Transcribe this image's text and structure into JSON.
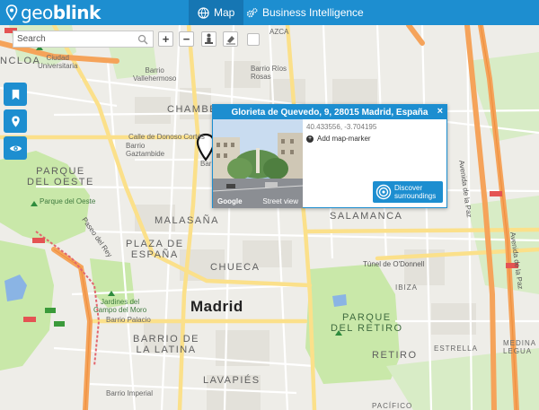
{
  "header": {
    "logo_light": "geo",
    "logo_bold": "blink",
    "tabs": [
      {
        "label": "Map",
        "active": true,
        "icon": "globe-icon"
      },
      {
        "label": "Business Intelligence",
        "active": false,
        "icon": "gears-icon"
      }
    ]
  },
  "toolbar": {
    "search_placeholder": "Search",
    "zoom_in": "+",
    "zoom_out": "−"
  },
  "sidebar": {
    "buttons": [
      {
        "icon": "bookmark-icon"
      },
      {
        "icon": "location-pin-icon"
      },
      {
        "icon": "eye-icon"
      }
    ]
  },
  "popup": {
    "title": "Glorieta de Quevedo, 9, 28015 Madrid, España",
    "close": "×",
    "coords": "40.433556, -3.704195",
    "add_marker": "Add map-marker",
    "discover_line1": "Discover",
    "discover_line2": "surroundings",
    "photo_brand": "Google",
    "photo_caption": "Street view"
  },
  "map_labels": {
    "azca": "AZCA",
    "moncloa": "NCLOA",
    "ciudad_univ": "Ciudad\nUniversitaria",
    "vallehermoso": "Barrio\nVallehermoso",
    "rios_rosas": "Barrio Ríos\nRosas",
    "chamberi": "CHAMBER",
    "donoso": "Calle de Donoso Cortés",
    "gaztambide": "Barrio\nGaztambide",
    "parque_oeste_big": "PARQUE\nDEL OESTE",
    "parque_oeste": "Parque del Oeste",
    "paseo_rey": "Paseo del Rey",
    "malasana": "MALASAÑA",
    "salamanca": "SALAMANCA",
    "plaza_espana": "PLAZA DE\nESPAÑA",
    "chueca": "CHUECA",
    "tunel": "Túnel de O'Donnell",
    "ibiza": "IBIZA",
    "madrid": "Madrid",
    "jardines": "Jardines del\nCampo del Moro",
    "palacio": "Barrio Palacio",
    "parque_retiro": "PARQUE\nDEL RETIRO",
    "latina": "BARRIO DE\nLA LATINA",
    "retiro": "RETIRO",
    "estrella": "ESTRELLA",
    "medina": "MEDINA\nLEGUA",
    "imperial": "Barrio Imperial",
    "lavapies": "LAVAPIÉS",
    "pacifico": "PACÍFICO",
    "av_paz": "Avenida de la Paz",
    "bar_partial": "Bar"
  },
  "colors": {
    "brand": "#1d8ed0",
    "park": "#c9e8a9",
    "highway": "#f5a35a",
    "major_road": "#fbe08a"
  }
}
